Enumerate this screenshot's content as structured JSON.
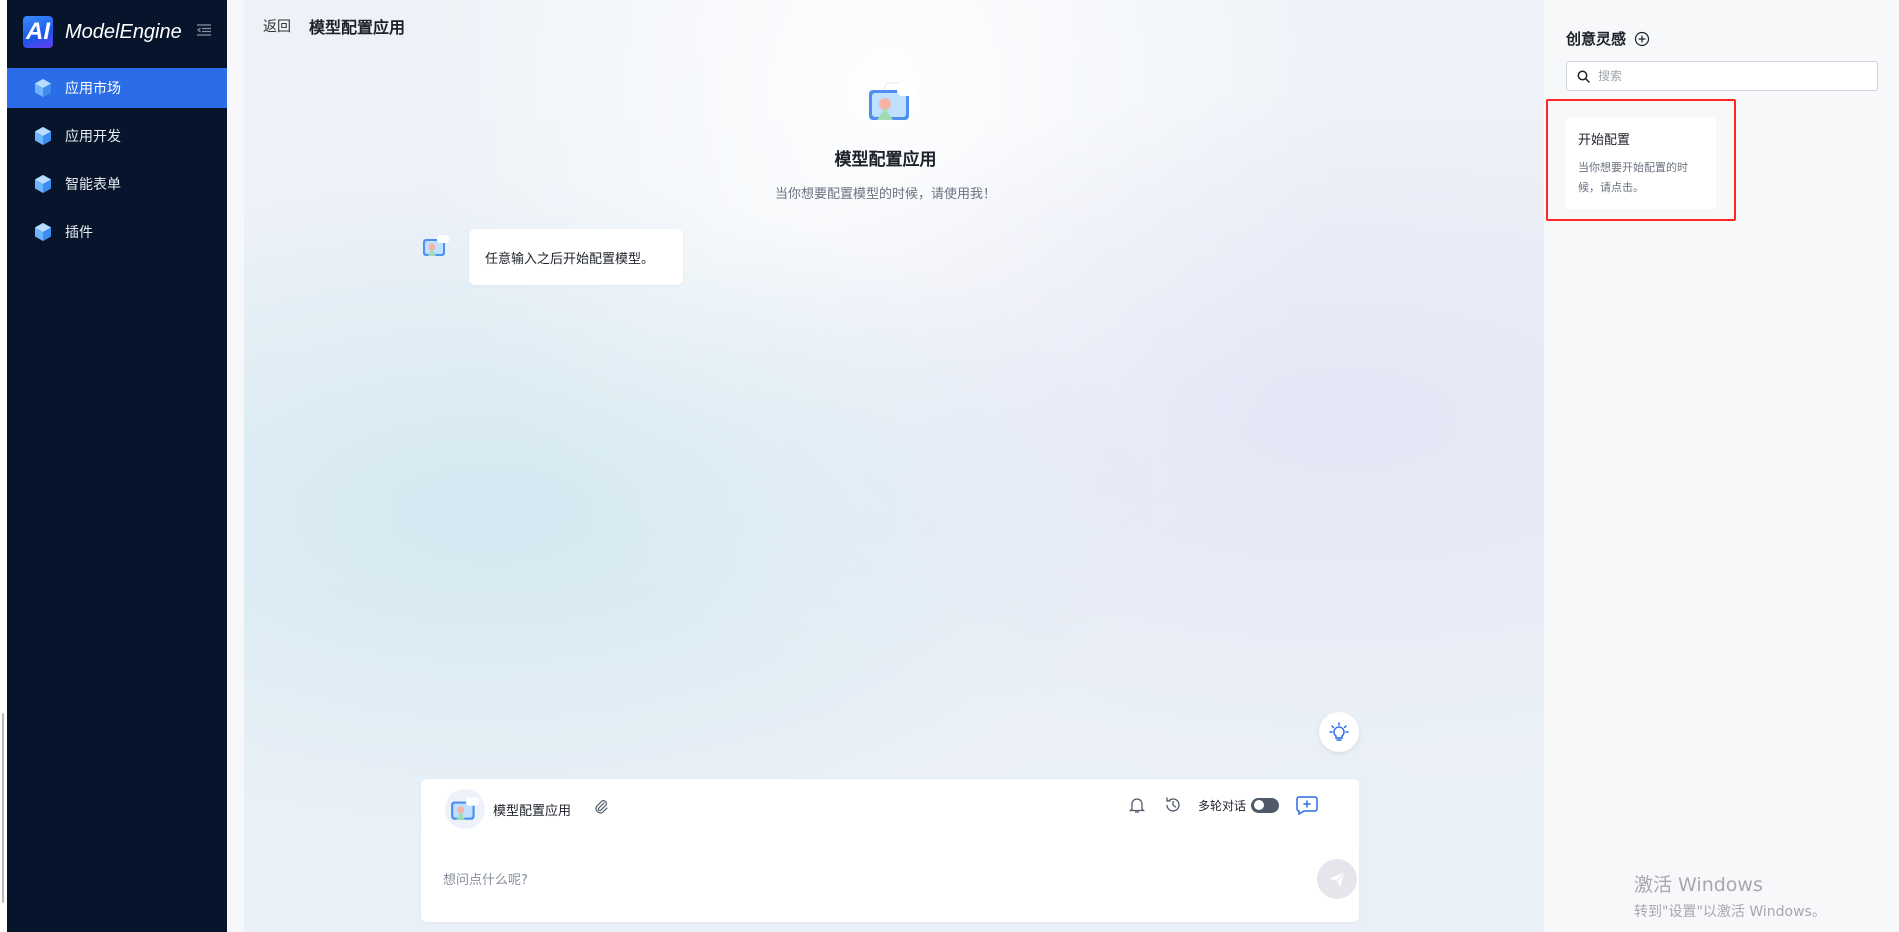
{
  "sidebar": {
    "logo_mark": "AI",
    "brand": "ModelEngine",
    "items": [
      {
        "label": "应用市场",
        "active": true
      },
      {
        "label": "应用开发",
        "active": false
      },
      {
        "label": "智能表单",
        "active": false
      },
      {
        "label": "插件",
        "active": false
      }
    ]
  },
  "header": {
    "back_label": "返回",
    "title": "模型配置应用"
  },
  "intro": {
    "name": "模型配置应用",
    "description": "当你想要配置模型的时候，请使用我！"
  },
  "messages": [
    {
      "text": "任意输入之后开始配置模型。"
    }
  ],
  "composer": {
    "app_name": "模型配置应用",
    "multi_turn_label": "多轮对话",
    "multi_turn_enabled": false,
    "placeholder": "想问点什么呢?"
  },
  "inspiration": {
    "title": "创意灵感",
    "search_placeholder": "搜索",
    "cards": [
      {
        "title": "开始配置",
        "description": "当你想要开始配置的时候，请点击。"
      }
    ]
  },
  "watermark": {
    "line1": "激活 Windows",
    "line2": "转到\"设置\"以激活 Windows。"
  },
  "colors": {
    "sidebar_bg": "#06152b",
    "active_nav": "#2b6de6",
    "highlight_border": "#ff2424"
  }
}
